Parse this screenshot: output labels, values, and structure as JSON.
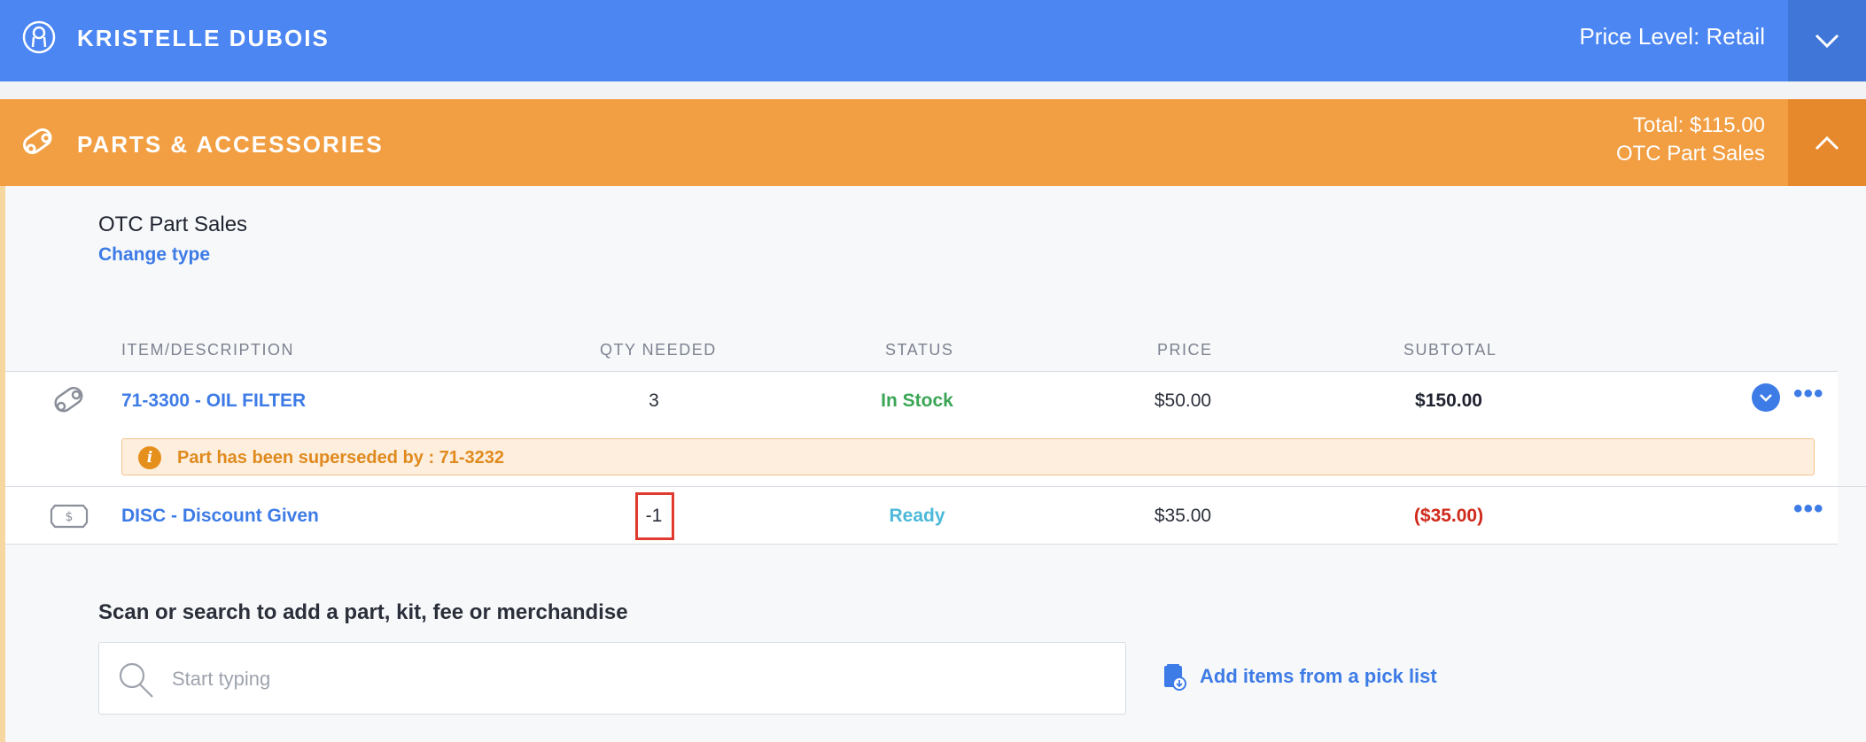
{
  "customer": {
    "name": "KRISTELLE DUBOIS",
    "price_level": "Price Level: Retail"
  },
  "parts": {
    "title": "PARTS & ACCESSORIES",
    "total": "Total: $115.00",
    "sale_type": "OTC Part Sales"
  },
  "panel": {
    "sale_type": "OTC Part Sales",
    "change_type": "Change type"
  },
  "table": {
    "headers": [
      "ITEM/DESCRIPTION",
      "QTY NEEDED",
      "STATUS",
      "PRICE",
      "SUBTOTAL"
    ],
    "rows": [
      {
        "icon": "part-icon",
        "item": "71-3300 - OIL FILTER",
        "qty": "3",
        "status": "In Stock",
        "price": "$50.00",
        "subtotal": "$150.00",
        "notice": "Part has been superseded by : 71-3232"
      },
      {
        "icon": "discount-icon",
        "item": "DISC - Discount Given",
        "qty": "-1",
        "status": "Ready",
        "price": "$35.00",
        "subtotal": "($35.00)"
      }
    ]
  },
  "search": {
    "label": "Scan or search to add a part, kit, fee or merchandise",
    "placeholder": "Start typing",
    "value": ""
  },
  "picklist": {
    "label": "Add items from a pick list"
  },
  "colors": {
    "customer_bar": "#4b86f2",
    "parts_bar": "#f29e42",
    "link": "#3d7be6",
    "in_stock": "#3aa655",
    "ready": "#4cb9d9",
    "negative": "#cf2a1b"
  }
}
